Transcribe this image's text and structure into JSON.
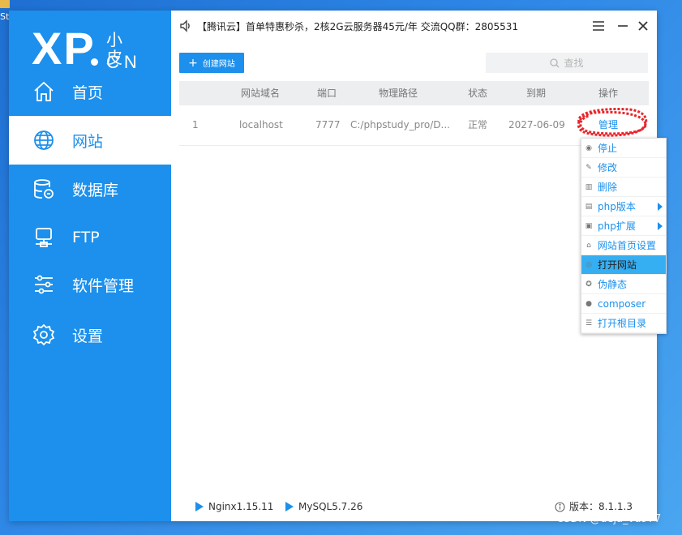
{
  "desktop": {
    "icon_label": "Stu"
  },
  "sidebar": {
    "logo": {
      "brand": "XP",
      "cn_top": "小皮",
      "cn_bottom": "CN"
    },
    "items": [
      {
        "label": "首页",
        "icon": "home-icon"
      },
      {
        "label": "网站",
        "icon": "globe-icon",
        "active": true
      },
      {
        "label": "数据库",
        "icon": "database-icon"
      },
      {
        "label": "FTP",
        "icon": "ftp-icon"
      },
      {
        "label": "软件管理",
        "icon": "sliders-icon"
      },
      {
        "label": "设置",
        "icon": "gear-icon"
      }
    ]
  },
  "header": {
    "announcement": "【腾讯云】首单特惠秒杀，2核2G云服务器45元/年 交流QQ群：2805531"
  },
  "toolbar": {
    "create_label": "创建网站",
    "search_placeholder": "查找"
  },
  "table": {
    "columns": [
      "网站域名",
      "端口",
      "物理路径",
      "状态",
      "到期",
      "操作"
    ],
    "rows": [
      {
        "index": "1",
        "domain": "localhost",
        "port": "7777",
        "path": "C:/phpstudy_pro/D...",
        "status": "正常",
        "expire": "2027-06-09",
        "action": "管理"
      }
    ]
  },
  "context_menu": {
    "items": [
      {
        "label": "停止",
        "icon": "stop-icon"
      },
      {
        "label": "修改",
        "icon": "edit-icon"
      },
      {
        "label": "删除",
        "icon": "trash-icon"
      },
      {
        "label": "php版本",
        "icon": "php-version-icon",
        "submenu": true
      },
      {
        "label": "php扩展",
        "icon": "php-extension-icon",
        "submenu": true
      },
      {
        "label": "网站首页设置",
        "icon": "home-settings-icon"
      },
      {
        "label": "打开网站",
        "icon": "open-site-icon",
        "highlighted": true
      },
      {
        "label": "伪静态",
        "icon": "rewrite-icon"
      },
      {
        "label": "composer",
        "icon": "composer-icon"
      },
      {
        "label": "打开根目录",
        "icon": "folder-list-icon"
      }
    ]
  },
  "footer": {
    "nginx": "Nginx1.15.11",
    "mysql": "MySQL5.7.26",
    "version": "版本：8.1.1.3"
  },
  "watermark": "CSDN @deja_vu977",
  "colors": {
    "accent": "#1c90ec",
    "highlight": "#35aef2",
    "annotation": "#e8262b"
  }
}
